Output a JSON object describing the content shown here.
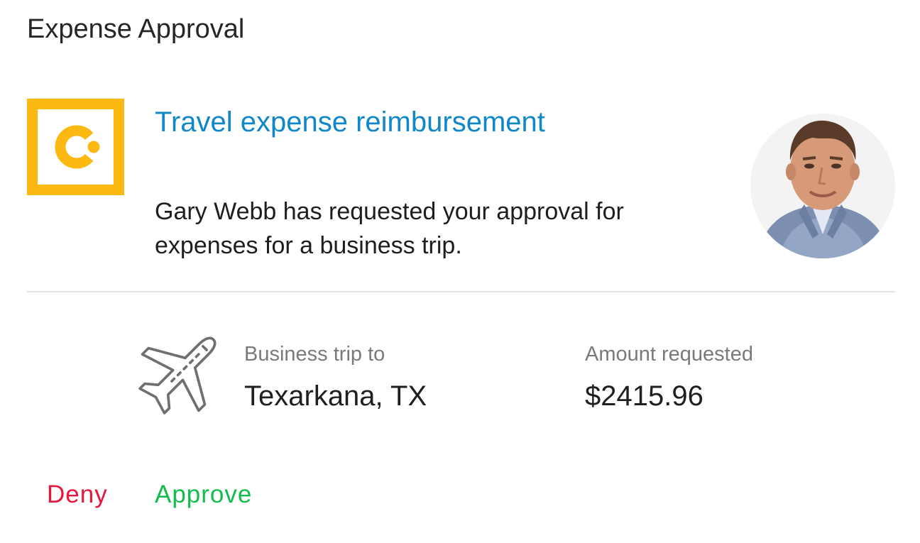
{
  "header": {
    "title": "Expense Approval"
  },
  "request": {
    "app_logo_icon": "brand-c-logo-icon",
    "title": "Travel expense reimbursement",
    "description": "Gary Webb has requested your approval for expenses for a business trip.",
    "requester_avatar": "person-photo-avatar"
  },
  "details": {
    "trip_icon": "airplane-icon",
    "trip_label": "Business trip to",
    "trip_destination": "Texarkana, TX",
    "amount_label": "Amount requested",
    "amount_value": "$2415.96"
  },
  "actions": {
    "deny_label": "Deny",
    "approve_label": "Approve"
  },
  "colors": {
    "brand_yellow": "#FDB912",
    "title_blue": "#1087C9",
    "deny_red": "#E8173E",
    "approve_green": "#12BC4D"
  }
}
